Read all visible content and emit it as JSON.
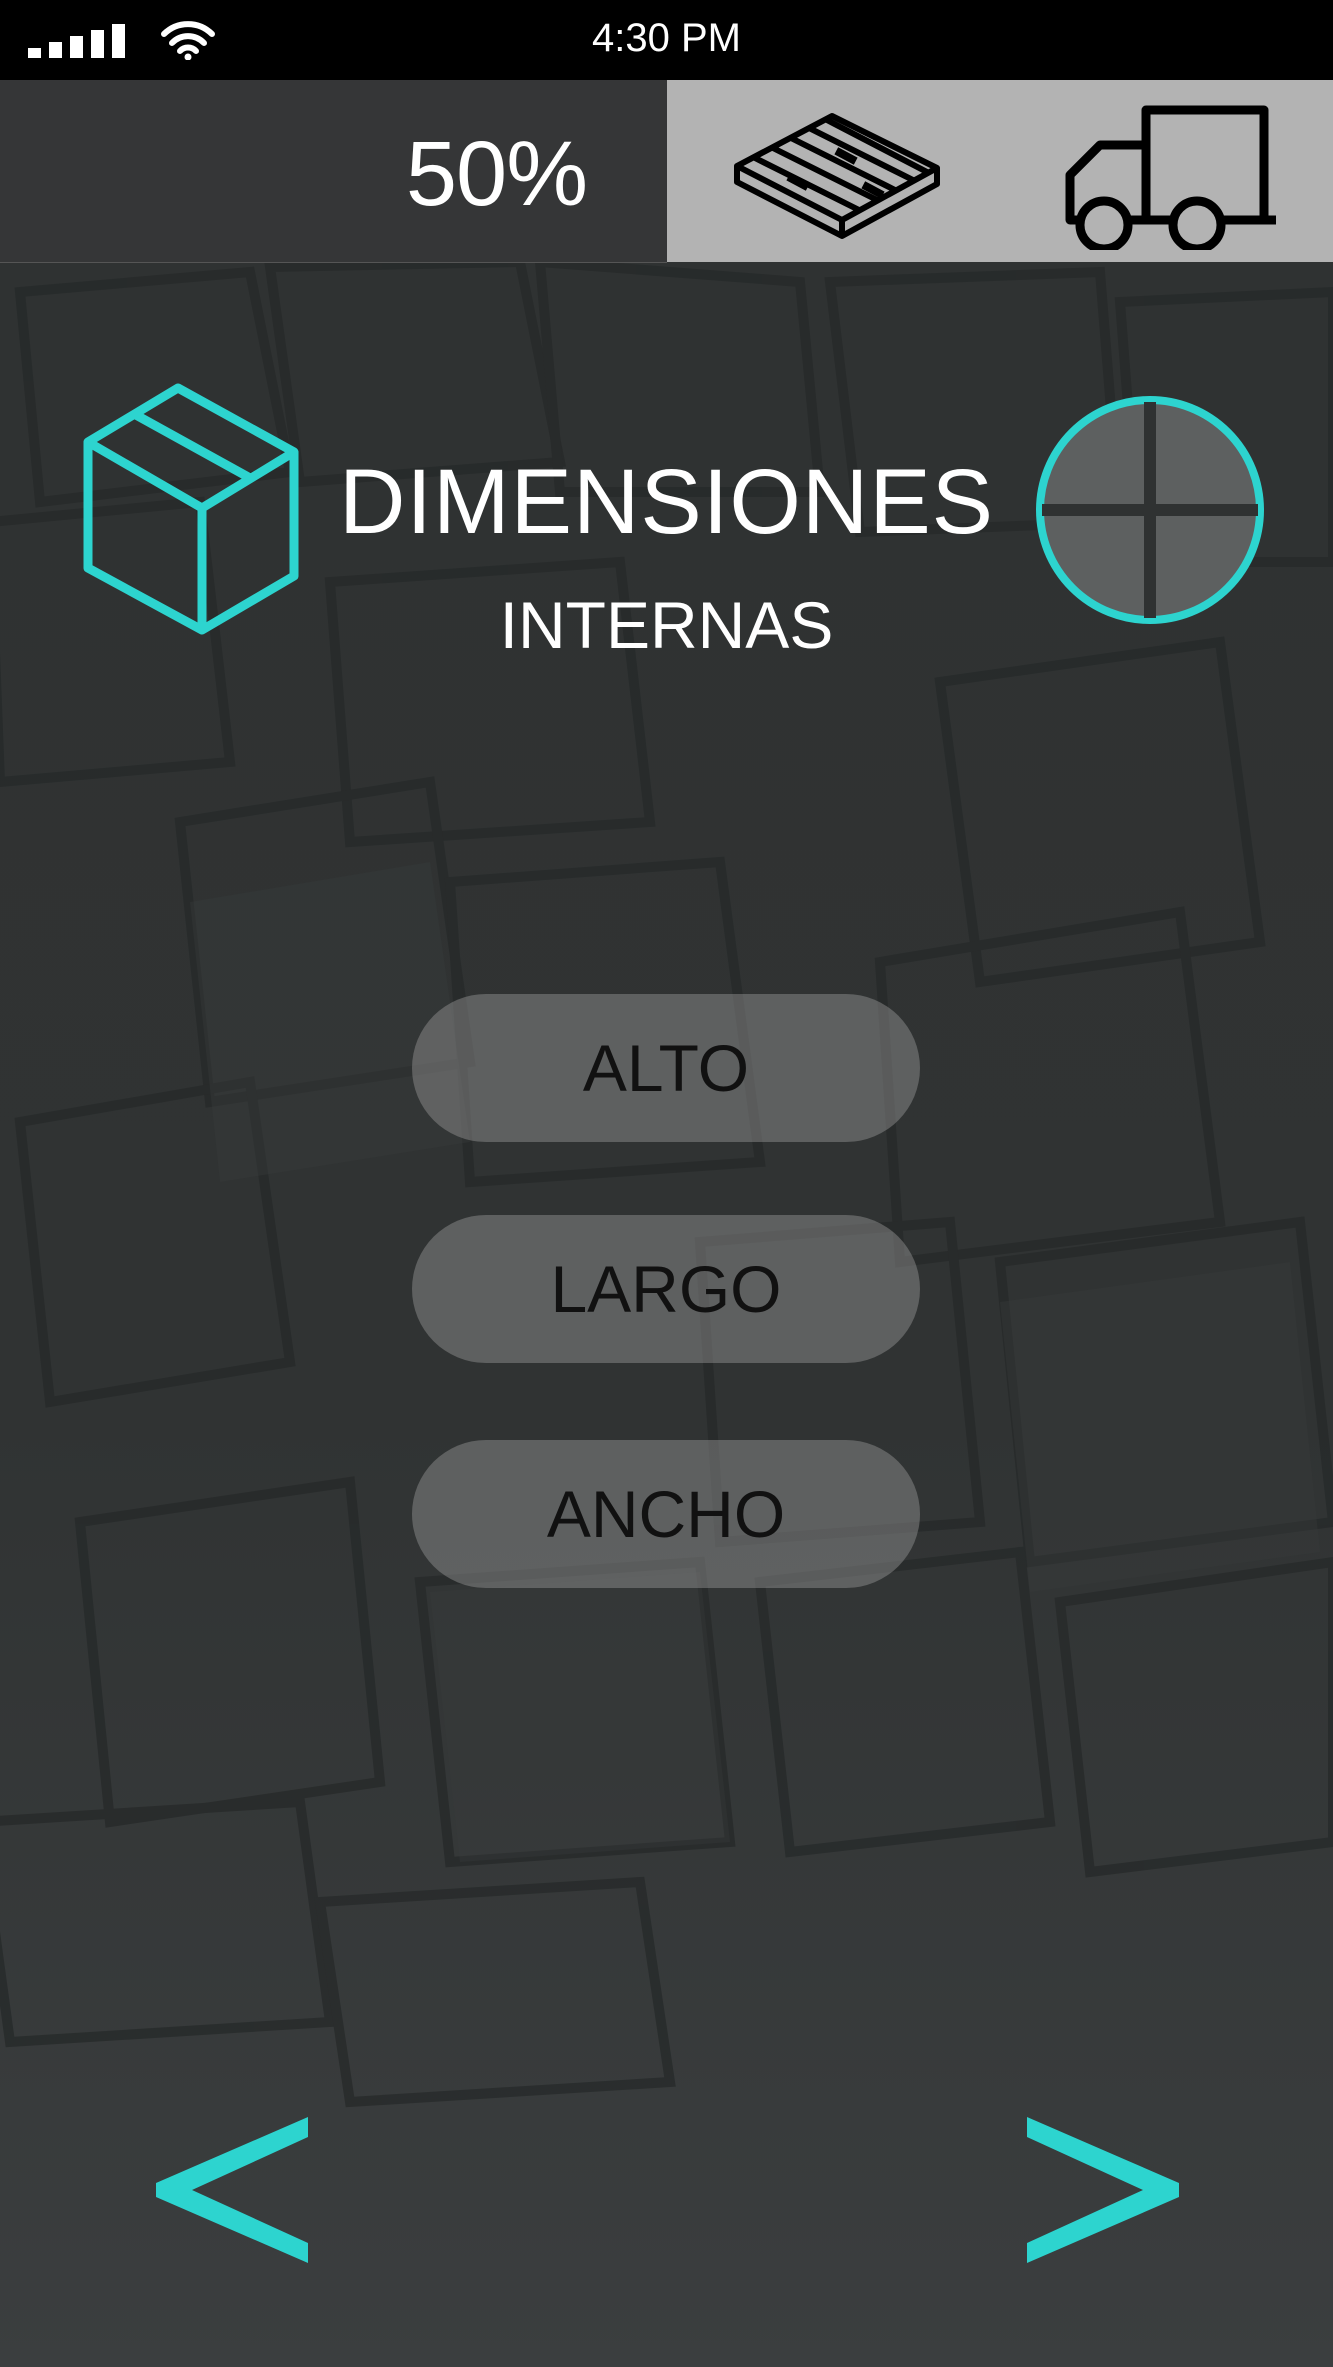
{
  "status_bar": {
    "time": "4:30 PM",
    "signal_icon": "signal-bars-icon",
    "wifi_icon": "wifi-icon"
  },
  "top_bar": {
    "progress_label": "50%",
    "progress_value": 0.5,
    "mode_icons": [
      "pallet-icon",
      "truck-icon"
    ]
  },
  "header": {
    "icon": "box-icon",
    "title": "DIMENSIONES",
    "subtitle": "INTERNAS",
    "action_icon": "crosshair-icon"
  },
  "dimensions": {
    "alto_label": "ALTO",
    "largo_label": "LARGO",
    "ancho_label": "ANCHO"
  },
  "navigation": {
    "prev_label": "<",
    "next_label": ">"
  },
  "colors": {
    "accent": "#2dd4cf",
    "status_bar": "#000000",
    "top_left_panel": "#353637",
    "top_right_panel": "#b3b3b3",
    "background": "#2f3232",
    "button_fill": "#8a8a8a"
  }
}
